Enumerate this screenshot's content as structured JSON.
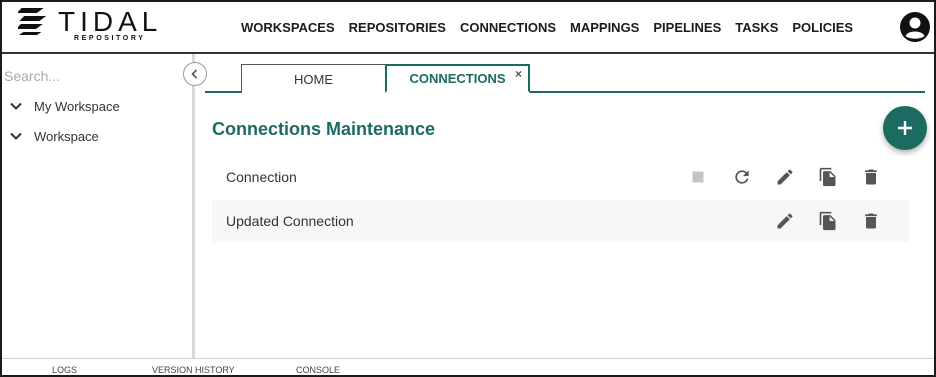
{
  "logo": {
    "word": "TIDAL",
    "sub": "REPOSITORY"
  },
  "nav": {
    "items": [
      {
        "label": "WORKSPACES"
      },
      {
        "label": "REPOSITORIES"
      },
      {
        "label": "CONNECTIONS"
      },
      {
        "label": "MAPPINGS"
      },
      {
        "label": "PIPELINES"
      },
      {
        "label": "TASKS"
      },
      {
        "label": "POLICIES"
      }
    ]
  },
  "sidebar": {
    "search_placeholder": "Search...",
    "items": [
      {
        "label": "My Workspace"
      },
      {
        "label": "Workspace"
      }
    ]
  },
  "tabs": [
    {
      "label": "HOME",
      "active": false
    },
    {
      "label": "CONNECTIONS",
      "active": true,
      "close": "×"
    }
  ],
  "main": {
    "title": "Connections Maintenance",
    "rows": [
      {
        "name": "Connection",
        "actions": [
          "stop-icon",
          "refresh-icon",
          "edit-icon",
          "copy-icon",
          "delete-icon"
        ]
      },
      {
        "name": "Updated Connection",
        "actions": [
          "edit-icon",
          "copy-icon",
          "delete-icon"
        ]
      }
    ]
  },
  "footer": {
    "items": [
      {
        "label": "LOGS"
      },
      {
        "label": "VERSION HISTORY"
      },
      {
        "label": "CONSOLE"
      }
    ]
  },
  "colors": {
    "accent": "#1b6b62",
    "icon": "#555555",
    "disabled_icon": "#c4c4c4"
  }
}
